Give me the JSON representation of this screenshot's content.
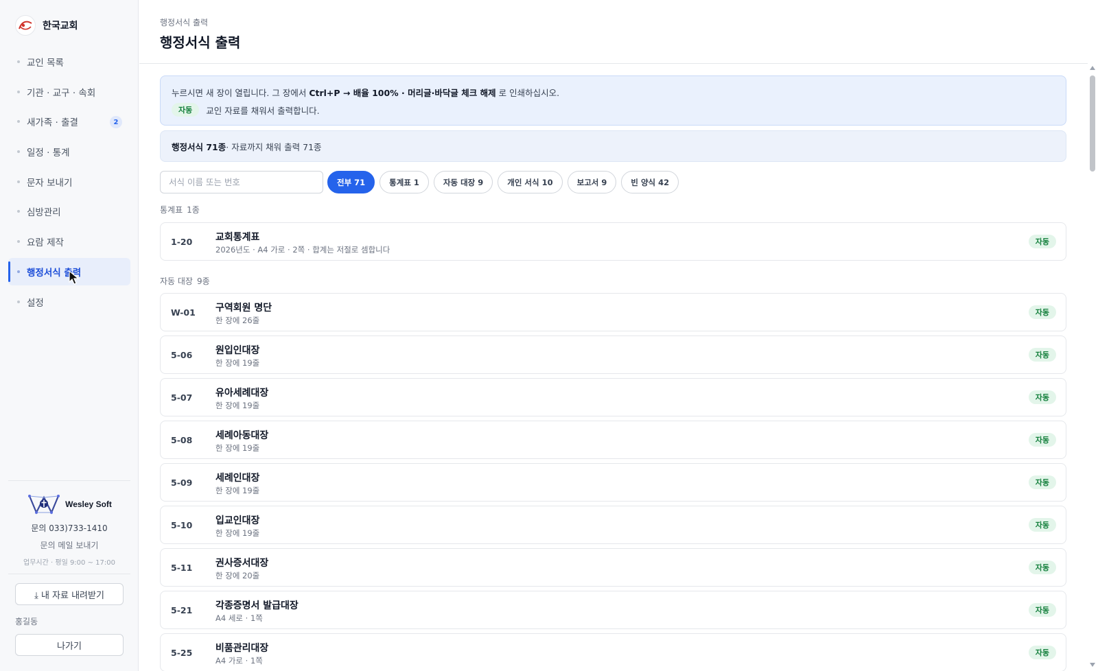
{
  "sidebar": {
    "brand_name": "한국교회",
    "items": [
      {
        "label": "교인 목록"
      },
      {
        "label": "기관 · 교구 · 속회"
      },
      {
        "label": "새가족 · 출결",
        "badge": "2"
      },
      {
        "label": "일정 · 통계"
      },
      {
        "label": "문자 보내기"
      },
      {
        "label": "심방관리"
      },
      {
        "label": "요람 제작"
      },
      {
        "label": "행정서식 출력"
      },
      {
        "label": "설정"
      }
    ],
    "company_name": "Wesley Soft",
    "contact": "문의 033)733-1410",
    "mail_link": "문의 메일 보내기",
    "hours": "업무시간 · 평일 9:00 ~ 17:00",
    "download_label": "⤓ 내 자료 내려받기",
    "user_name": "홍길동",
    "exit_label": "나가기"
  },
  "header": {
    "breadcrumb": "행정서식 출력",
    "title": "행정서식 출력"
  },
  "notice": {
    "text_pre": "누르시면 새 장이 열립니다. 그 장에서 ",
    "text_keys": "Ctrl+P → 배율 100% · 머리글·바닥글 체크 해제",
    "text_post": " 로 인쇄하십시오.",
    "tag": "자동",
    "tag_desc": "교인 자료를 채워서 출력합니다."
  },
  "summary": {
    "bold": "행정서식 71종",
    "rest": " · 자료까지 채워 출력 71종"
  },
  "search": {
    "placeholder": "서식 이름 또는 번호"
  },
  "filters": [
    {
      "label": "전부 71",
      "active": true
    },
    {
      "label": "통계표 1"
    },
    {
      "label": "자동 대장 9"
    },
    {
      "label": "개인 서식 10"
    },
    {
      "label": "보고서 9"
    },
    {
      "label": "빈 양식 42"
    }
  ],
  "sections": [
    {
      "name": "통계표",
      "count": "1종",
      "items": [
        {
          "code": "1-20",
          "title": "교회통계표",
          "desc": "2026년도 · A4 가로 · 2쪽 · 합계는 저절로 셈합니다",
          "tag": "자동"
        }
      ]
    },
    {
      "name": "자동 대장",
      "count": "9종",
      "items": [
        {
          "code": "W-01",
          "title": "구역회원 명단",
          "desc": "한 장에 26줄",
          "tag": "자동"
        },
        {
          "code": "5-06",
          "title": "원입인대장",
          "desc": "한 장에 19줄",
          "tag": "자동"
        },
        {
          "code": "5-07",
          "title": "유아세례대장",
          "desc": "한 장에 19줄",
          "tag": "자동"
        },
        {
          "code": "5-08",
          "title": "세례아동대장",
          "desc": "한 장에 19줄",
          "tag": "자동"
        },
        {
          "code": "5-09",
          "title": "세례인대장",
          "desc": "한 장에 19줄",
          "tag": "자동"
        },
        {
          "code": "5-10",
          "title": "입교인대장",
          "desc": "한 장에 19줄",
          "tag": "자동"
        },
        {
          "code": "5-11",
          "title": "권사증서대장",
          "desc": "한 장에 20줄",
          "tag": "자동"
        },
        {
          "code": "5-21",
          "title": "각종증명서 발급대장",
          "desc": "A4 세로 · 1쪽",
          "tag": "자동"
        },
        {
          "code": "5-25",
          "title": "비품관리대장",
          "desc": "A4 가로 · 1쪽",
          "tag": "자동"
        }
      ]
    }
  ],
  "colors": {
    "accent": "#2563eb",
    "tag_bg": "#e3f5ea",
    "tag_text": "#15803d",
    "notice_bg": "#eaf1fd"
  }
}
